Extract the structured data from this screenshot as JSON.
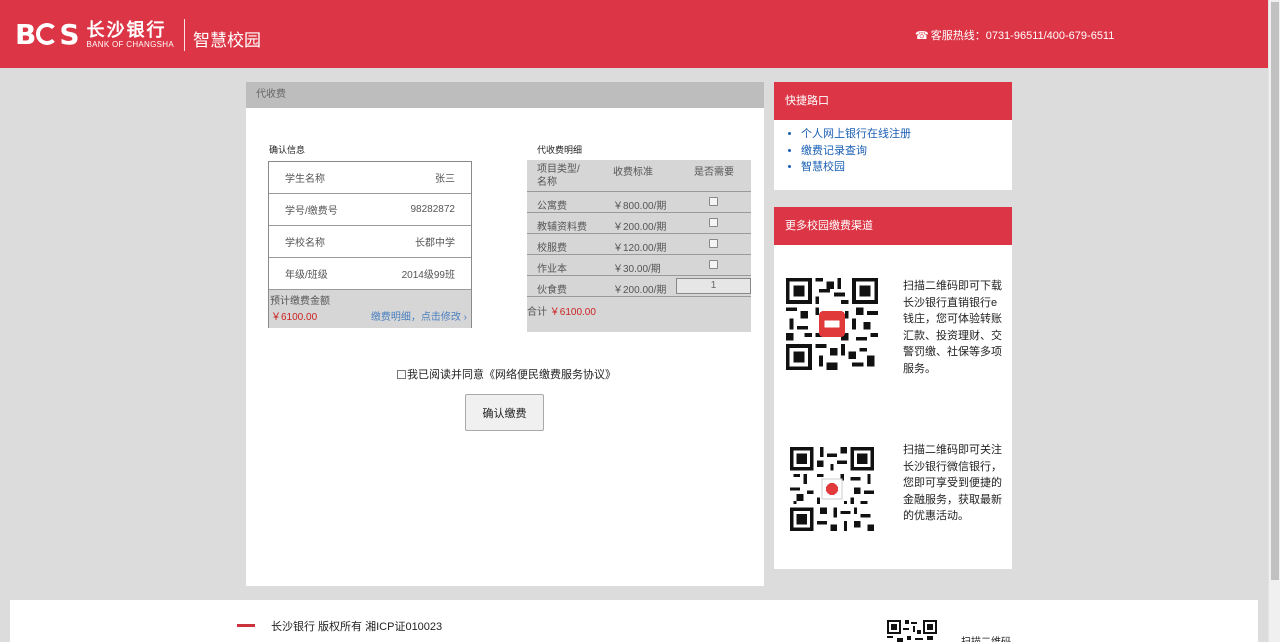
{
  "header": {
    "logo_mark": "BCS",
    "bank_name_cn": "长沙银行",
    "bank_name_en": "BANK OF CHANGSHA",
    "subtitle": "智慧校园",
    "hotline_icon": "phone-icon",
    "hotline": "客服热线：0731-96511/400-679-6511"
  },
  "main": {
    "panel_title": "代收费",
    "confirm_section_title": "确认信息",
    "info_rows": [
      {
        "label": "学生名称",
        "value": "张三"
      },
      {
        "label": "学号/缴费号",
        "value": "98282872"
      },
      {
        "label": "学校名称",
        "value": "长郡中学"
      },
      {
        "label": "年级/班级",
        "value": "2014级99班"
      }
    ],
    "estimated_label": "预计缴费金额",
    "estimated_amount": "￥6100.00",
    "detail_link": "缴费明细，点击修改",
    "fee_section_title": "代收费明细",
    "fee_headers": [
      "项目类型/名称",
      "收费标准",
      "是否需要"
    ],
    "fee_rows": [
      {
        "name": "公寓费",
        "rate": "￥800.00/期",
        "checked": false
      },
      {
        "name": "教辅资料费",
        "rate": "￥200.00/期",
        "checked": false
      },
      {
        "name": "校服费",
        "rate": "￥120.00/期",
        "checked": false
      },
      {
        "name": "作业本",
        "rate": "￥30.00/期",
        "checked": false
      }
    ],
    "meal_row": {
      "name": "伙食费",
      "rate": "￥200.00/期",
      "quantity": "1"
    },
    "total_label": "合计",
    "total_amount": "￥6100.00",
    "agreement_text": "我已阅读并同意《网络便民缴费服务协议》",
    "confirm_button": "确认缴费"
  },
  "sidebar": {
    "quick_title": "快捷路口",
    "quick_links": [
      "个人网上银行在线注册",
      "缴费记录查询",
      "智慧校园"
    ],
    "more_title": "更多校园缴费渠道",
    "qr1_text": "扫描二维码即可下载长沙银行直销银行e钱庄，您可体验转账汇款、投资理财、交警罚缴、社保等多项服务。",
    "qr2_text": "扫描二维码即可关注长沙银行微信银行，您即可享受到便捷的金融服务，获取最新的优惠活动。"
  },
  "footer": {
    "copyright": "长沙银行 版权所有 湘ICP证010023",
    "qr_text": "扫描二维码"
  },
  "colors": {
    "brand_red": "#dc3545",
    "amount_red": "#cc2222",
    "link_blue": "#1a5fb4"
  }
}
